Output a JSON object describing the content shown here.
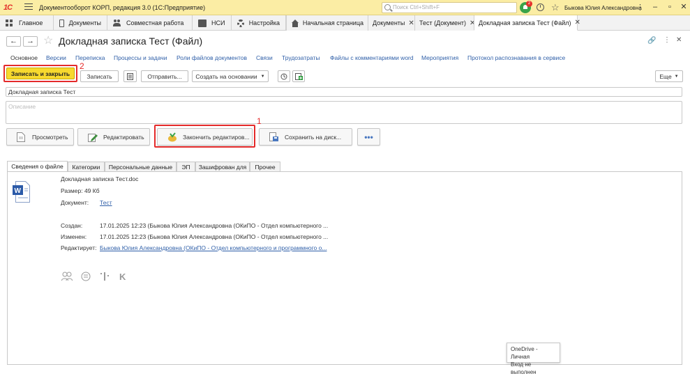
{
  "titlebar": {
    "logo": "1С",
    "app_title": "Документооборот КОРП, редакция 3.0  (1С:Предприятие)",
    "search_placeholder": "Поиск Ctrl+Shift+F",
    "notifications_count": "2",
    "user": "Быкова Юлия Александровна"
  },
  "sections": [
    "Главное",
    "Документы",
    "Совместная работа",
    "НСИ",
    "Настройка"
  ],
  "tabs": [
    {
      "label": "Начальная страница"
    },
    {
      "label": "Документы"
    },
    {
      "label": "Тест (Документ)"
    },
    {
      "label": "Докладная записка Тест (Файл)"
    }
  ],
  "form": {
    "title": "Докладная записка Тест (Файл)",
    "links": [
      "Основное",
      "Версии",
      "Переписка",
      "Процессы и задачи",
      "Роли файлов документов",
      "Связи",
      "Трудозатраты",
      "Файлы с комментариями word",
      "Мероприятия",
      "Протокол распознавания в сервисе"
    ],
    "toolbar": {
      "save_close": "Записать и закрыть",
      "save": "Записать",
      "send": "Отправить...",
      "create_based": "Создать на основании",
      "more": "Еще"
    },
    "markers": {
      "one": "1",
      "two": "2"
    },
    "name_value": "Докладная записка Тест",
    "description_placeholder": "Описание",
    "action_buttons": {
      "view": "Просмотреть",
      "edit": "Редактировать",
      "finish_edit": "Закончить редактиров...",
      "save_disk": "Сохранить на диск..."
    },
    "file_tabs": [
      "Сведения о файле",
      "Категории",
      "Персональные данные",
      "ЭП",
      "Зашифрован для",
      "Прочее"
    ],
    "info": {
      "file_name": "Докладная записка Тест.doc",
      "size": "Размер: 49 Кб",
      "document_label": "Документ:",
      "document_value": "Тест",
      "created_label": "Создан:",
      "created_value": "17.01.2025 12:23 (Быкова Юлия Александровна (ОКиПО - Отдел компьютерного ...",
      "changed_label": "Изменен:",
      "changed_value": "17.01.2025 12:23 (Быкова Юлия Александровна (ОКиПО - Отдел компьютерного ...",
      "editor_label": "Редактирует:",
      "editor_value": "Быкова Юлия Александровна (ОКиПО - Отдел компьютерного и программного о..."
    }
  },
  "tooltip": {
    "line1": "OneDrive - Личная",
    "line2": "Вход не выполнен"
  },
  "colors": {
    "titlebar": "#fbeda4",
    "accent_yellow": "#f7d92e",
    "highlight_red": "#e42a2a",
    "link": "#2f5fa8"
  }
}
